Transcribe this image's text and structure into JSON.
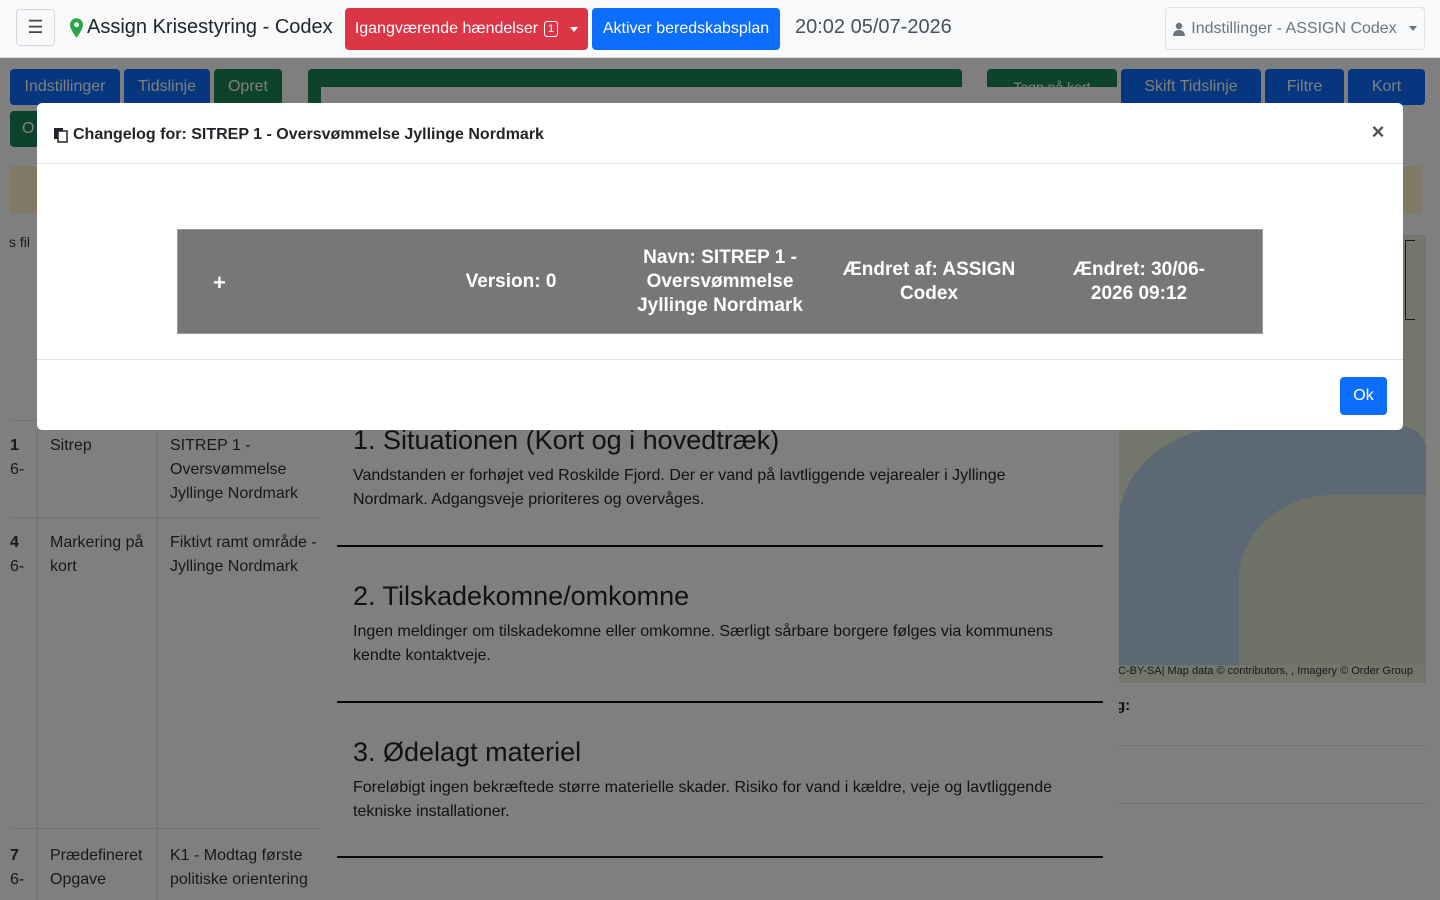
{
  "navbar": {
    "brand": "Assign Krisestyring - Codex",
    "events_button": "Igangværende hændelser",
    "events_count": "1",
    "activate_button": "Aktiver beredskabsplan",
    "datetime": "20:02 05/07-2026",
    "settings_dropdown": "Indstillinger - ASSIGN Codex"
  },
  "background": {
    "toolbar": {
      "settings": "Indstillinger",
      "timeline": "Tidslinje",
      "create": "Opret",
      "draw_on_map": "Tegn på kort",
      "switch_timeline": "Skift Tidslinje",
      "filters": "Filtre",
      "map": "Kort"
    },
    "filter_label": "s fil",
    "rows": [
      {
        "num": "1",
        "sub": "6-",
        "type": "Sitrep",
        "text": "SITREP 1 - Oversvømmelse Jyllinge Nordmark"
      },
      {
        "num": "4",
        "sub": "6-",
        "type": "Markering på kort",
        "text": "Fiktivt ramt område - Jyllinge Nordmark"
      },
      {
        "num": "7",
        "sub": "6-",
        "type": "Prædefineret Opgave",
        "text": "K1 - Modtag første politiske orientering"
      }
    ],
    "map_attribution": "C-BY-SA| Map data © contributors, , Imagery © Order Group",
    "side_label": "g:",
    "document": {
      "sections": [
        {
          "heading": "1. Situationen (Kort og i hovedtræk)",
          "body": "Vandstanden er forhøjet ved Roskilde Fjord. Der er vand på lavtliggende vejarealer i Jyllinge Nordmark. Adgangsveje prioriteres og overvåges."
        },
        {
          "heading": "2. Tilskadekomne/omkomne",
          "body": "Ingen meldinger om tilskadekomne eller omkomne. Særligt sårbare borgere følges via kommunens kendte kontaktveje."
        },
        {
          "heading": "3. Ødelagt materiel",
          "body": "Foreløbigt ingen bekræftede større materielle skader. Risiko for vand i kældre, veje og lavtliggende tekniske installationer."
        }
      ]
    }
  },
  "modal": {
    "title": "Changelog for: SITREP 1 - Oversvømmelse Jyllinge Nordmark",
    "close_symbol": "×",
    "entry": {
      "expand": "+",
      "version": "Version: 0",
      "name": "Navn: SITREP 1 - Oversvømmelse Jyllinge Nordmark",
      "changed_by": "Ændret af: ASSIGN Codex",
      "changed_at": "Ændret: 30/06-2026 09:12"
    },
    "ok_button": "Ok"
  }
}
